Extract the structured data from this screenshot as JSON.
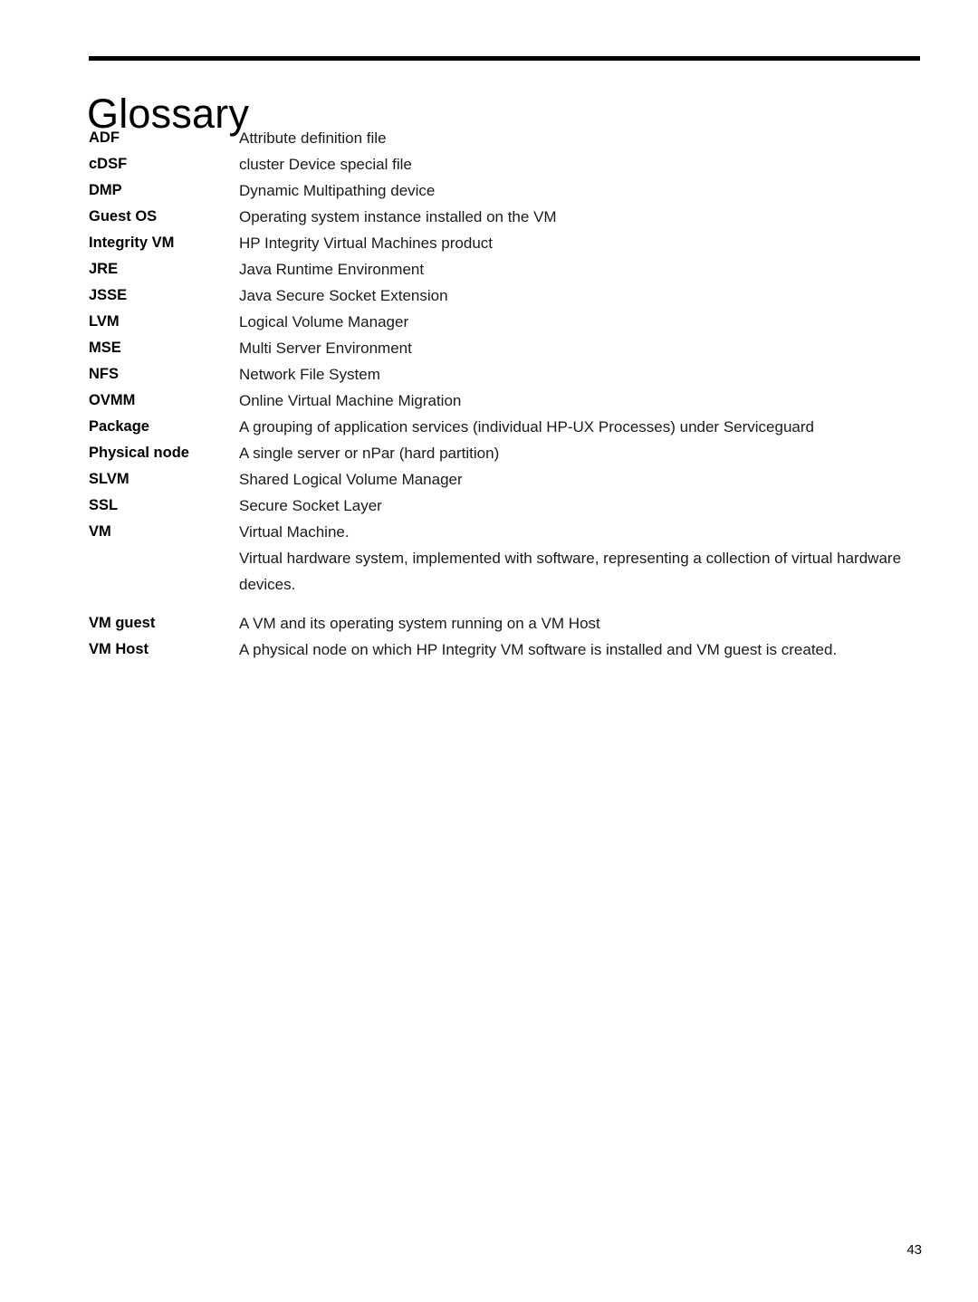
{
  "document": {
    "title": "Glossary",
    "page_number": "43"
  },
  "glossary": {
    "entries": [
      {
        "term": "ADF",
        "definitions": [
          "Attribute definition file"
        ]
      },
      {
        "term": "cDSF",
        "definitions": [
          "cluster Device special file"
        ]
      },
      {
        "term": "DMP",
        "definitions": [
          "Dynamic Multipathing device"
        ]
      },
      {
        "term": "Guest OS",
        "definitions": [
          "Operating system instance installed on the VM"
        ]
      },
      {
        "term": "Integrity VM",
        "definitions": [
          "HP Integrity Virtual Machines product"
        ]
      },
      {
        "term": "JRE",
        "definitions": [
          "Java Runtime Environment"
        ]
      },
      {
        "term": "JSSE",
        "definitions": [
          "Java Secure Socket Extension"
        ]
      },
      {
        "term": "LVM",
        "definitions": [
          "Logical Volume Manager"
        ]
      },
      {
        "term": "MSE",
        "definitions": [
          "Multi Server Environment"
        ]
      },
      {
        "term": "NFS",
        "definitions": [
          "Network File System"
        ]
      },
      {
        "term": "OVMM",
        "definitions": [
          "Online Virtual Machine Migration"
        ]
      },
      {
        "term": "Package",
        "definitions": [
          "A grouping of application services (individual HP-UX Processes) under Serviceguard"
        ]
      },
      {
        "term": "Physical node",
        "definitions": [
          "A single server or nPar (hard partition)"
        ]
      },
      {
        "term": "SLVM",
        "definitions": [
          "Shared Logical Volume Manager"
        ]
      },
      {
        "term": "SSL",
        "definitions": [
          "Secure Socket Layer"
        ]
      },
      {
        "term": "VM",
        "definitions": [
          "Virtual Machine.",
          "Virtual hardware system, implemented with software, representing a collection of virtual hardware devices."
        ]
      },
      {
        "term": "VM guest",
        "definitions": [
          "A VM and its operating system running on a VM Host"
        ]
      },
      {
        "term": "VM Host",
        "definitions": [
          "A physical node on which HP Integrity VM software is installed and VM guest is created."
        ]
      }
    ]
  }
}
